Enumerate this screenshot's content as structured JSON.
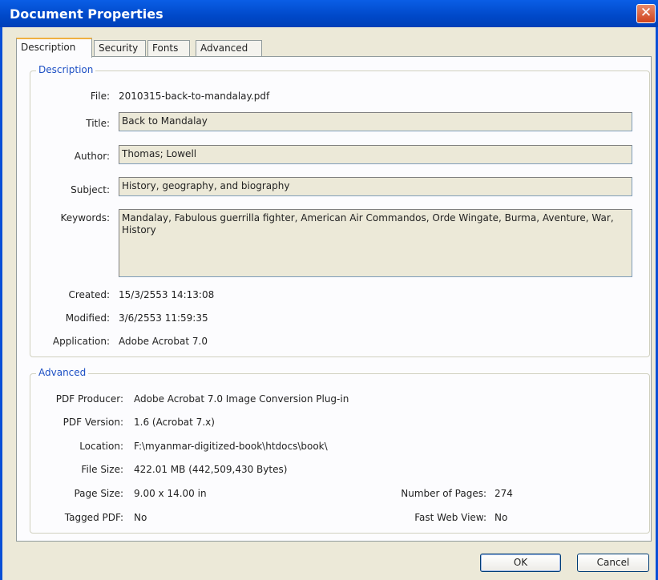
{
  "window": {
    "title": "Document Properties",
    "close_glyph": "✕"
  },
  "tabs": [
    "Description",
    "Security",
    "Fonts",
    "Advanced"
  ],
  "description": {
    "legend": "Description",
    "file_label": "File:",
    "file_value": "2010315-back-to-mandalay.pdf",
    "title_label": "Title:",
    "title_value": "Back to Mandalay",
    "author_label": "Author:",
    "author_value": "Thomas; Lowell",
    "subject_label": "Subject:",
    "subject_value": "History, geography, and biography",
    "keywords_label": "Keywords:",
    "keywords_value": "Mandalay, Fabulous guerrilla fighter, American Air Commandos, Orde Wingate, Burma, Aventure, War, History",
    "created_label": "Created:",
    "created_value": "15/3/2553 14:13:08",
    "modified_label": "Modified:",
    "modified_value": "3/6/2553 11:59:35",
    "application_label": "Application:",
    "application_value": "Adobe Acrobat 7.0"
  },
  "advanced": {
    "legend": "Advanced",
    "producer_label": "PDF Producer:",
    "producer_value": "Adobe Acrobat 7.0 Image Conversion Plug-in",
    "version_label": "PDF Version:",
    "version_value": "1.6 (Acrobat 7.x)",
    "location_label": "Location:",
    "location_value": "F:\\myanmar-digitized-book\\htdocs\\book\\",
    "filesize_label": "File Size:",
    "filesize_value": "422.01 MB (442,509,430 Bytes)",
    "pagesize_label": "Page Size:",
    "pagesize_value": "9.00 x 14.00 in",
    "pages_label": "Number of Pages:",
    "pages_value": "274",
    "tagged_label": "Tagged PDF:",
    "tagged_value": "No",
    "fastweb_label": "Fast Web View:",
    "fastweb_value": "No"
  },
  "buttons": {
    "ok": "OK",
    "cancel": "Cancel"
  }
}
